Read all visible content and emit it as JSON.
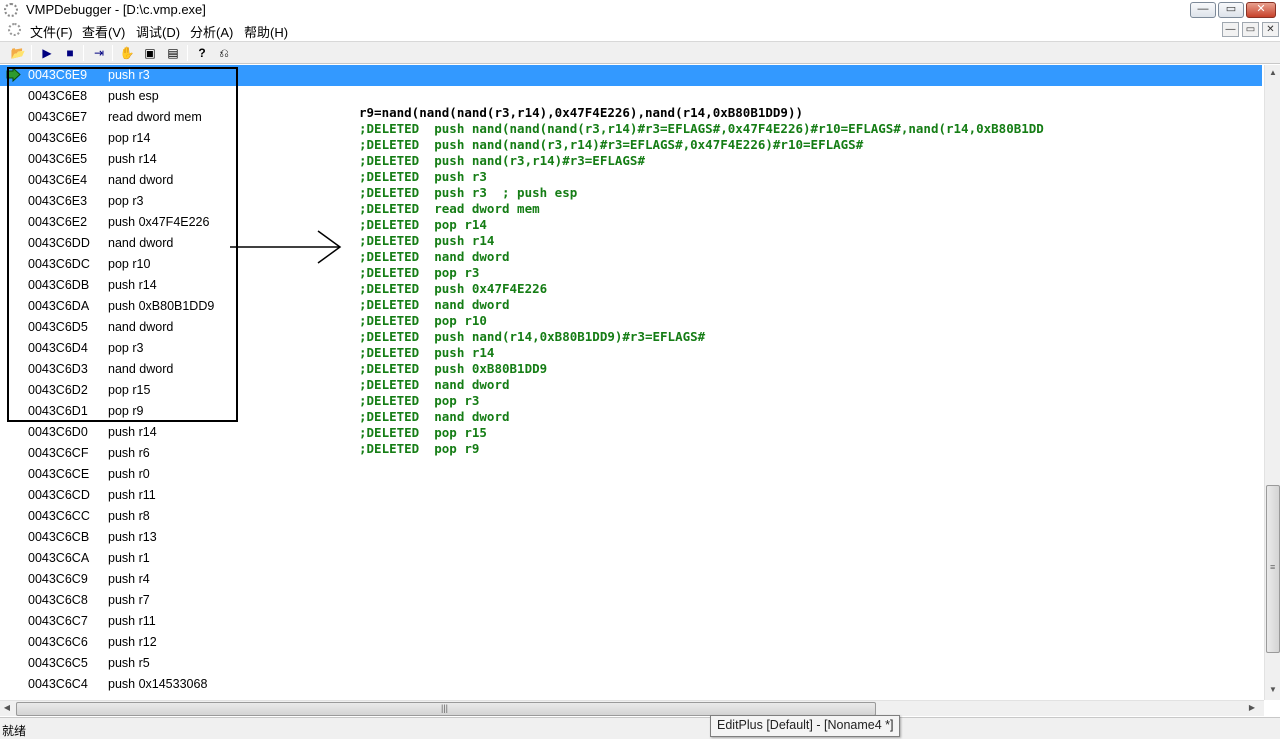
{
  "window": {
    "title": "VMPDebugger - [D:\\c.vmp.exe]",
    "minimize_glyph": "—",
    "maximize_glyph": "▭",
    "close_glyph": "✕"
  },
  "menu": {
    "items": [
      "文件(F)",
      "查看(V)",
      "调试(D)",
      "分析(A)",
      "帮助(H)"
    ]
  },
  "toolbar": {
    "icons": [
      "open-folder-icon",
      "run-icon",
      "stop-icon",
      "step-icon",
      "hand-icon",
      "memory-icon",
      "list-icon",
      "help-icon",
      "arrow-back-icon"
    ],
    "glyphs": [
      "📂",
      "▶",
      "■",
      "⇥",
      "✋",
      "▣",
      "▤",
      "?",
      "⎌"
    ]
  },
  "listing": {
    "selected_index": 0,
    "rows": [
      {
        "addr": "0043C6E9",
        "instr": "push r3"
      },
      {
        "addr": "0043C6E8",
        "instr": "push esp"
      },
      {
        "addr": "0043C6E7",
        "instr": "read dword mem"
      },
      {
        "addr": "0043C6E6",
        "instr": "pop r14"
      },
      {
        "addr": "0043C6E5",
        "instr": "push r14"
      },
      {
        "addr": "0043C6E4",
        "instr": "nand dword"
      },
      {
        "addr": "0043C6E3",
        "instr": "pop r3"
      },
      {
        "addr": "0043C6E2",
        "instr": "push 0x47F4E226"
      },
      {
        "addr": "0043C6DD",
        "instr": "nand dword"
      },
      {
        "addr": "0043C6DC",
        "instr": "pop r10"
      },
      {
        "addr": "0043C6DB",
        "instr": "push r14"
      },
      {
        "addr": "0043C6DA",
        "instr": "push 0xB80B1DD9"
      },
      {
        "addr": "0043C6D5",
        "instr": "nand dword"
      },
      {
        "addr": "0043C6D4",
        "instr": "pop r3"
      },
      {
        "addr": "0043C6D3",
        "instr": "nand dword"
      },
      {
        "addr": "0043C6D2",
        "instr": "pop r15"
      },
      {
        "addr": "0043C6D1",
        "instr": "pop r9"
      },
      {
        "addr": "0043C6D0",
        "instr": "push r14"
      },
      {
        "addr": "0043C6CF",
        "instr": "push r6"
      },
      {
        "addr": "0043C6CE",
        "instr": "push r0"
      },
      {
        "addr": "0043C6CD",
        "instr": "push r11"
      },
      {
        "addr": "0043C6CC",
        "instr": "push r8"
      },
      {
        "addr": "0043C6CB",
        "instr": "push r13"
      },
      {
        "addr": "0043C6CA",
        "instr": "push r1"
      },
      {
        "addr": "0043C6C9",
        "instr": "push r4"
      },
      {
        "addr": "0043C6C8",
        "instr": "push r7"
      },
      {
        "addr": "0043C6C7",
        "instr": "push r11"
      },
      {
        "addr": "0043C6C6",
        "instr": "push r12"
      },
      {
        "addr": "0043C6C5",
        "instr": "push r5"
      },
      {
        "addr": "0043C6C4",
        "instr": "push 0x14533068"
      }
    ]
  },
  "analysis": {
    "lines": [
      {
        "text": "r9=nand(nand(nand(r3,r14),0x47F4E226),nand(r14,0xB80B1DD9))",
        "color": "#000000"
      },
      {
        "text": ";DELETED  push nand(nand(nand(r3,r14)#r3=EFLAGS#,0x47F4E226)#r10=EFLAGS#,nand(r14,0xB80B1DD",
        "color": "#157d15"
      },
      {
        "text": ";DELETED  push nand(nand(r3,r14)#r3=EFLAGS#,0x47F4E226)#r10=EFLAGS#",
        "color": "#157d15"
      },
      {
        "text": ";DELETED  push nand(r3,r14)#r3=EFLAGS#",
        "color": "#157d15"
      },
      {
        "text": ";DELETED  push r3",
        "color": "#157d15"
      },
      {
        "text": ";DELETED  push r3  ; push esp",
        "color": "#157d15"
      },
      {
        "text": ";DELETED  read dword mem",
        "color": "#157d15"
      },
      {
        "text": ";DELETED  pop r14",
        "color": "#157d15"
      },
      {
        "text": ";DELETED  push r14",
        "color": "#157d15"
      },
      {
        "text": ";DELETED  nand dword",
        "color": "#157d15"
      },
      {
        "text": ";DELETED  pop r3",
        "color": "#157d15"
      },
      {
        "text": ";DELETED  push 0x47F4E226",
        "color": "#157d15"
      },
      {
        "text": ";DELETED  nand dword",
        "color": "#157d15"
      },
      {
        "text": ";DELETED  pop r10",
        "color": "#157d15"
      },
      {
        "text": ";DELETED  push nand(r14,0xB80B1DD9)#r3=EFLAGS#",
        "color": "#157d15"
      },
      {
        "text": ";DELETED  push r14",
        "color": "#157d15"
      },
      {
        "text": ";DELETED  push 0xB80B1DD9",
        "color": "#157d15"
      },
      {
        "text": ";DELETED  nand dword",
        "color": "#157d15"
      },
      {
        "text": ";DELETED  pop r3",
        "color": "#157d15"
      },
      {
        "text": ";DELETED  nand dword",
        "color": "#157d15"
      },
      {
        "text": ";DELETED  pop r15",
        "color": "#157d15"
      },
      {
        "text": ";DELETED  pop r9",
        "color": "#157d15"
      }
    ]
  },
  "status": {
    "text": "就绪",
    "tooltip": "EditPlus [Default] - [Noname4 *]"
  },
  "colors": {
    "selection": "#3399ff",
    "deleted_green": "#157d15"
  }
}
